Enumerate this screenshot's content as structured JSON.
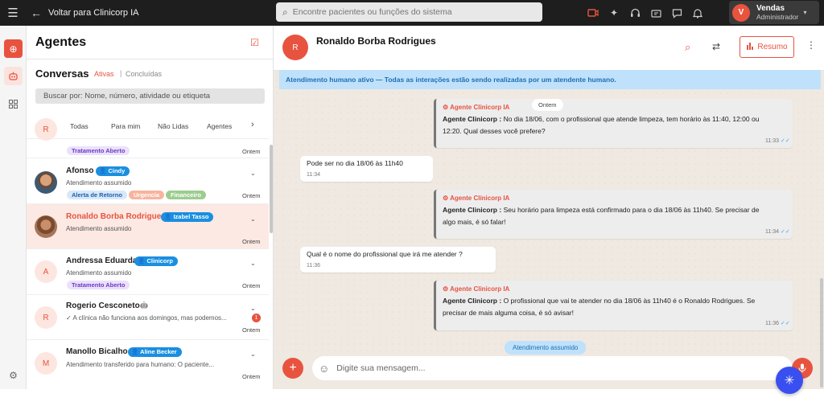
{
  "topbar": {
    "back_label": "Voltar para Clinicorp IA",
    "search_placeholder": "Encontre pacientes ou funções do sistema",
    "user_initial": "V",
    "user_name": "Vendas",
    "user_role": "Administrador"
  },
  "left": {
    "title": "Agentes",
    "conversations_title": "Conversas",
    "active_label": "Ativas",
    "separator": "|",
    "done_label": "Concluídas",
    "search_placeholder": "Buscar por: Nome, número, atividade ou etiqueta",
    "tabs": [
      "Todas",
      "Para mim",
      "Não Lidas",
      "Agentes"
    ]
  },
  "conversations": [
    {
      "initial": "R",
      "tags": [
        "Tratamento Aberto"
      ],
      "time": "Ontem"
    },
    {
      "name": "Afonso",
      "agent": "Cindy",
      "status": "Atendimento assumido",
      "tags": [
        "Alerta de Retorno",
        "Urgencia",
        "Financeiro"
      ],
      "time": "Ontem"
    },
    {
      "name": "Ronaldo Borba Rodrigues",
      "agent": "Izabel Tasso",
      "status": "Atendimento assumido",
      "time": "Ontem"
    },
    {
      "initial": "A",
      "name": "Andressa Eduarda",
      "agent": "Clinicorp",
      "status": "Atendimento assumido",
      "tags": [
        "Tratamento Aberto"
      ],
      "time": "Ontem"
    },
    {
      "initial": "R",
      "name": "Rogerio Cesconeto",
      "preview": "A clínica não funciona aos domingos, mas podemos...",
      "unread": "1",
      "time": "Ontem"
    },
    {
      "initial": "M",
      "name": "Manollo Bicalho",
      "agent": "Aline Becker",
      "status": "Atendimento transferido para humano: O paciente...",
      "time": "Ontem"
    }
  ],
  "chat": {
    "contact_initial": "R",
    "contact_name": "Ronaldo Borba Rodrigues",
    "summary_button": "Resumo",
    "banner": "Atendimento humano ativo — Todas as interações estão sendo realizadas por um atendente humano.",
    "date_chip": "Ontem",
    "status_chip": "Atendimento assumido",
    "composer_placeholder": "Digite sua mensagem...",
    "messages": [
      {
        "from": "bot",
        "header": "Agente Clinicorp IA",
        "sender": "Agente Clinicorp :",
        "lines": [
          "No dia 18/06, com o profissional que atende limpeza, tem horário às 11:40, 12:00 ou",
          "12:20. Qual desses você prefere?"
        ],
        "time": "11:33"
      },
      {
        "from": "user",
        "text": "Pode ser no dia 18/06 às 11h40",
        "time": "11:34"
      },
      {
        "from": "bot",
        "header": "Agente Clinicorp IA",
        "sender": "Agente Clinicorp :",
        "lines": [
          "Seu horário para limpeza está confirmado para o dia 18/06 às 11h40. Se precisar de",
          "algo mais, é só falar!"
        ],
        "time": "11:34"
      },
      {
        "from": "user",
        "text": "Qual é o nome do profissional que irá me atender ?",
        "time": "11:36"
      },
      {
        "from": "bot",
        "header": "Agente Clinicorp IA",
        "sender": "Agente Clinicorp :",
        "lines": [
          "O profissional que vai te atender no dia 18/06 às 11h40 é o Ronaldo Rodrigues. Se",
          "precisar de mais alguma coisa, é só avisar!"
        ],
        "time": "11:36"
      }
    ]
  },
  "colors": {
    "accent": "#e8533f",
    "agent_badge": "#1a8fe0",
    "banner": "#bfe1fb",
    "fab": "#3a4ff0"
  }
}
